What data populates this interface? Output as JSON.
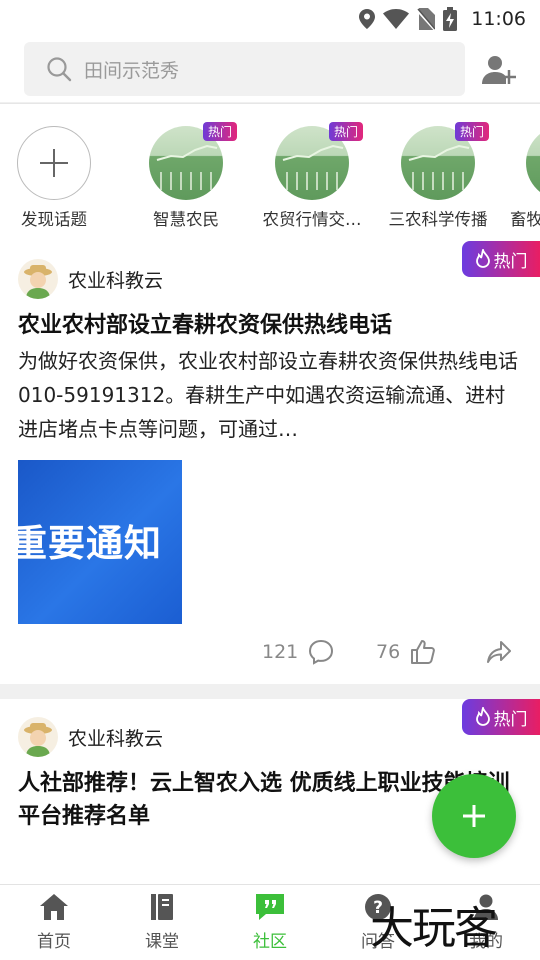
{
  "status_bar": {
    "time": "11:06"
  },
  "search": {
    "placeholder": "田间示范秀"
  },
  "topics": [
    {
      "label": "发现话题",
      "hot": ""
    },
    {
      "label": "智慧农民",
      "hot": "热门"
    },
    {
      "label": "农贸行情交…",
      "hot": "热门"
    },
    {
      "label": "三农科学传播",
      "hot": "热门"
    },
    {
      "label": "畜牧",
      "hot": ""
    }
  ],
  "posts": [
    {
      "hot_badge": "热门",
      "author": "农业科教云",
      "title": "农业农村部设立春耕农资保供热线电话",
      "body": "为做好农资保供，农业农村部设立春耕农资保供热线电话010-59191312。春耕生产中如遇农资运输流通、进村进店堵点卡点等问题，可通过…",
      "image_text": "重要通知",
      "comments": "121",
      "likes": "76"
    },
    {
      "hot_badge": "热门",
      "author": "农业科教云",
      "title": "人社部推荐！云上智农入选 优质线上职业技能培训平台推荐名单"
    }
  ],
  "bottom_nav": [
    {
      "label": "首页",
      "icon": "home-icon"
    },
    {
      "label": "课堂",
      "icon": "book-icon"
    },
    {
      "label": "社区",
      "icon": "chat-quote-icon"
    },
    {
      "label": "问答",
      "icon": "question-icon"
    },
    {
      "label": "我的",
      "icon": "user-icon"
    }
  ],
  "watermark": "大玩客",
  "colors": {
    "accent": "#3cbf3a",
    "hot_gradient_start": "#6c3ce0",
    "hot_gradient_end": "#e91e63",
    "image_blue": "#1f63d6"
  }
}
